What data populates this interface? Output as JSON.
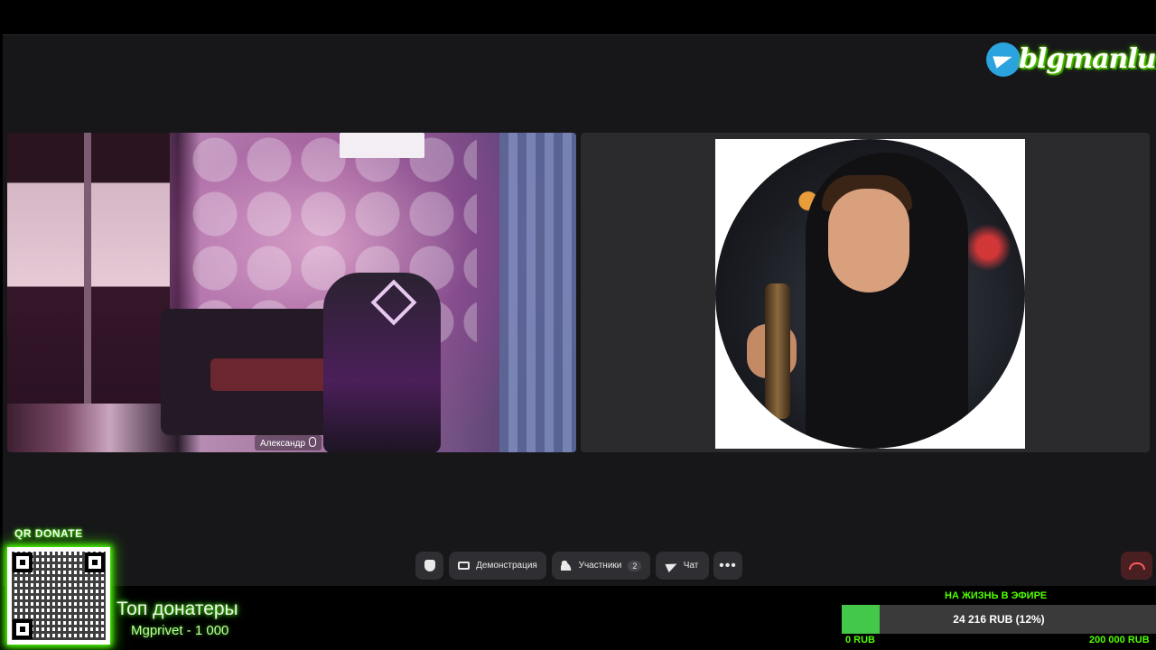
{
  "call": {
    "participant_name": "Александр",
    "toolbar": {
      "demo_label": "Демонстрация",
      "participants_label": "Участники",
      "participants_count": "2",
      "chat_label": "Чат"
    }
  },
  "overlay": {
    "brand_text": "blgmanlu",
    "qr_title": "QR DONATE",
    "top_donors_title": "Топ донатеры",
    "top_donors": [
      "Mgprivet - 1 000"
    ],
    "goal": {
      "title": "НА ЖИЗНЬ В ЭФИРЕ",
      "progress_text": "24 216 RUB (12%)",
      "progress_fraction": 0.12,
      "min_label": "0 RUB",
      "max_label": "200 000 RUB",
      "fill_color": "#44c84a"
    }
  },
  "colors": {
    "accent_green": "#50ff00",
    "hangup_red": "#ff5a5a",
    "telegram_blue": "#2aa3df"
  },
  "icons": {
    "raise_hand": "hand-icon",
    "screen_share": "screen-icon",
    "participants": "people-icon",
    "chat": "send-icon",
    "more": "more-dots-icon",
    "hangup": "phone-hangup-icon",
    "brand": "telegram-icon"
  }
}
